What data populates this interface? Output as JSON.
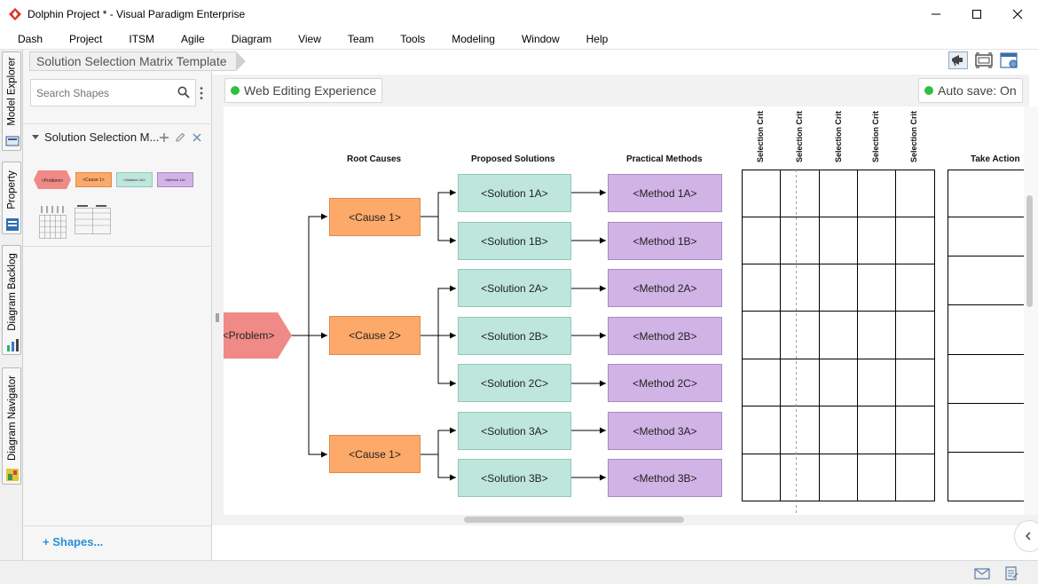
{
  "window": {
    "title": "Dolphin Project * - Visual Paradigm Enterprise"
  },
  "menu": [
    "Dash",
    "Project",
    "ITSM",
    "Agile",
    "Diagram",
    "View",
    "Team",
    "Tools",
    "Modeling",
    "Window",
    "Help"
  ],
  "side_tabs": [
    "Model Explorer",
    "Property",
    "Diagram Backlog",
    "Diagram Navigator"
  ],
  "breadcrumb": "Solution Selection Matrix Template",
  "search": {
    "placeholder": "Search Shapes"
  },
  "palette": {
    "section_title": "Solution Selection M...",
    "shape_labels": [
      "<Problem>",
      "<Cause 1>",
      "<Solution 1A>",
      "<Method 1A>"
    ],
    "shapes_link": "Shapes..."
  },
  "canvas_bar": {
    "editing_label": "Web Editing Experience",
    "autosave_label": "Auto save: On"
  },
  "diagram": {
    "headers": {
      "root_causes": "Root Causes",
      "proposed_solutions": "Proposed Solutions",
      "practical_methods": "Practical Methods",
      "selection_criteria": "Selection Crit",
      "take_action": "Take Action"
    },
    "problem": "<Problem>",
    "causes": [
      "<Cause 1>",
      "<Cause 2>",
      "<Cause 1>"
    ],
    "solutions": [
      "<Solution 1A>",
      "<Solution 1B>",
      "<Solution 2A>",
      "<Solution 2B>",
      "<Solution 2C>",
      "<Solution 3A>",
      "<Solution 3B>"
    ],
    "methods": [
      "<Method 1A>",
      "<Method 1B>",
      "<Method 2A>",
      "<Method 2B>",
      "<Method 2C>",
      "<Method 3A>",
      "<Method 3B>"
    ]
  },
  "colors": {
    "problem": "#f08a86",
    "cause": "#fca96a",
    "solution": "#bfe6dc",
    "method": "#d1b3e6",
    "status_ok": "#2fbf3f",
    "link": "#2b8fd6"
  }
}
